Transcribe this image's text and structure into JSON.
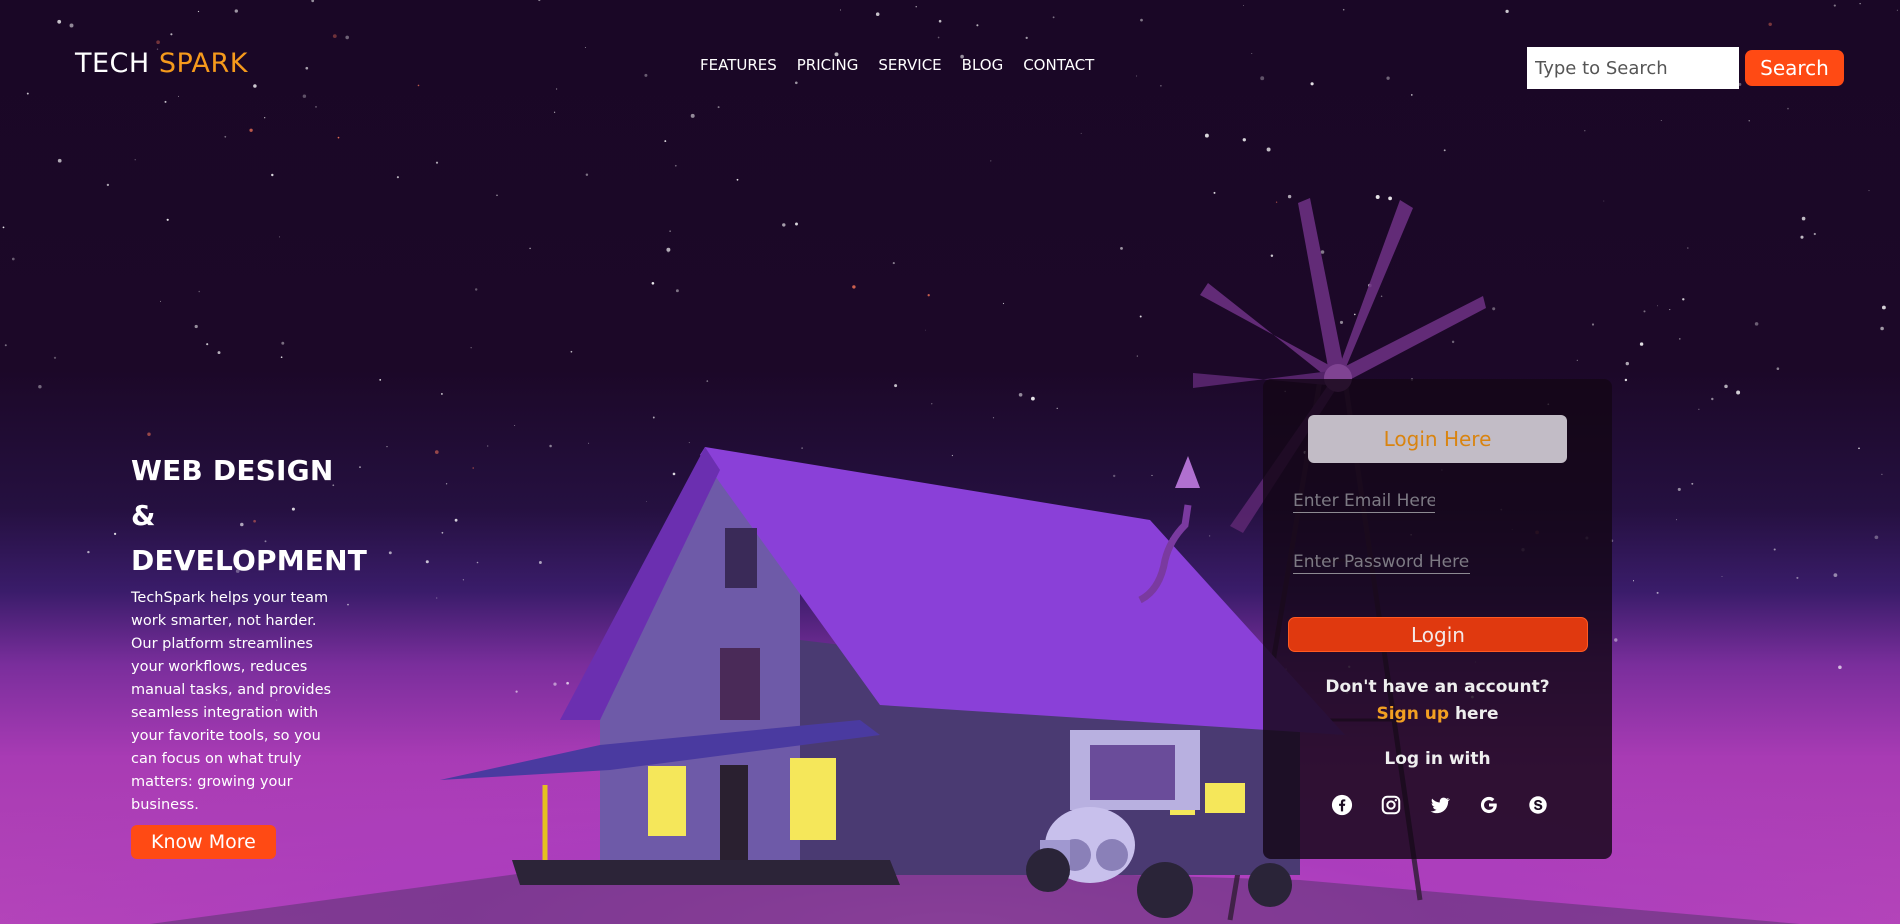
{
  "header": {
    "logo_part1": "TECH",
    "logo_part2": "SPARK",
    "nav": [
      "FEATURES",
      "PRICING",
      "SERVICE",
      "BLOG",
      "CONTACT"
    ],
    "search_placeholder": "Type to Search",
    "search_button": "Search"
  },
  "hero": {
    "title_line1": "WEB DESIGN &",
    "title_line2": "DEVELOPMENT",
    "description": "TechSpark helps your team work smarter, not harder. Our platform streamlines your workflows, reduces manual tasks, and provides seamless integration with your favorite tools, so you can focus on what truly matters: growing your business.",
    "button": "Know More"
  },
  "login": {
    "title": "Login Here",
    "email_placeholder": "Enter Email Here",
    "password_placeholder": "Enter Password Here",
    "button": "Login",
    "no_account": "Don't have an account?",
    "signup_link": "Sign up",
    "signup_suffix": "here",
    "login_with": "Log in with",
    "social_icons": [
      "facebook-icon",
      "instagram-icon",
      "twitter-icon",
      "google-icon",
      "skype-icon"
    ]
  },
  "colors": {
    "accent_orange": "#f59a1c",
    "button_red": "#ff4a14",
    "background_dark": "#1a0726",
    "horizon_magenta": "#b646b8"
  }
}
